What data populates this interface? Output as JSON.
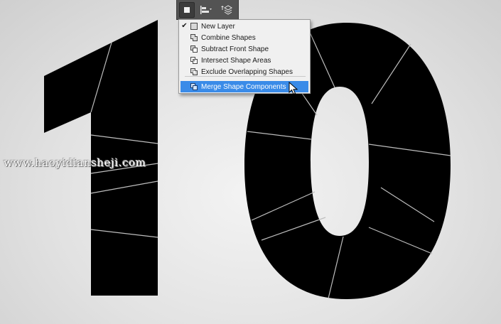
{
  "toolbar": {
    "buttons": [
      {
        "name": "path-operations",
        "icon": "square-icon",
        "active": true
      },
      {
        "name": "path-alignment",
        "icon": "align-icon"
      },
      {
        "name": "path-arrangement",
        "icon": "arrange-icon"
      }
    ]
  },
  "menu": {
    "items": [
      {
        "label": "New Layer",
        "checked": true,
        "icon": "new-layer-icon"
      },
      {
        "label": "Combine Shapes",
        "checked": false,
        "icon": "combine-shapes-icon"
      },
      {
        "label": "Subtract Front Shape",
        "checked": false,
        "icon": "subtract-front-shape-icon"
      },
      {
        "label": "Intersect Shape Areas",
        "checked": false,
        "icon": "intersect-shape-areas-icon"
      },
      {
        "label": "Exclude Overlapping Shapes",
        "checked": false,
        "icon": "exclude-overlapping-shapes-icon"
      }
    ],
    "highlighted": {
      "label": "Merge Shape Components",
      "icon": "merge-shape-components-icon"
    }
  },
  "canvas": {
    "content": "10",
    "shape_color": "#000000",
    "segment_line_color": "#bdbdbd"
  },
  "watermark": "www.haoyidiansheji.com",
  "colors": {
    "highlight": "#3a8be8",
    "menu_bg": "#f0f0f0",
    "toolbar_bg": "#535353"
  }
}
